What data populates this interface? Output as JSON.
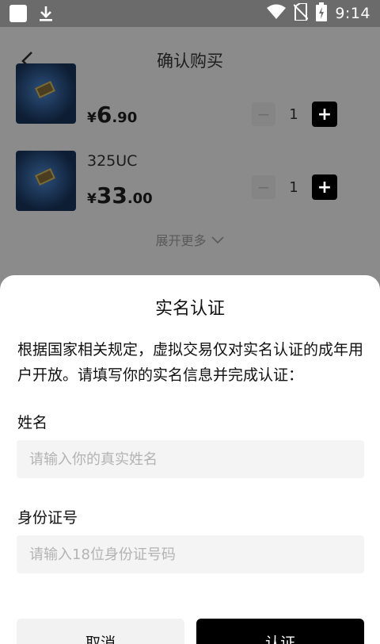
{
  "status_bar": {
    "time": "9:14"
  },
  "nav": {
    "title": "确认购买"
  },
  "products": [
    {
      "name": "",
      "price_symbol": "¥",
      "price_int": "6",
      "price_dec": ".90",
      "quantity": "1"
    },
    {
      "name": "325UC",
      "price_symbol": "¥",
      "price_int": "33",
      "price_dec": ".00",
      "quantity": "1"
    }
  ],
  "stepper": {
    "minus": "−",
    "plus": "+"
  },
  "more_label": "展开更多",
  "modal": {
    "title": "实名认证",
    "description": "根据国家相关规定，虚拟交易仅对实名认证的成年用户开放。请填写你的实名信息并完成认证：",
    "name_label": "姓名",
    "name_placeholder": "请输入你的真实姓名",
    "id_label": "身份证号",
    "id_placeholder": "请输入18位身份证号码",
    "cancel_label": "取消",
    "confirm_label": "认证"
  }
}
